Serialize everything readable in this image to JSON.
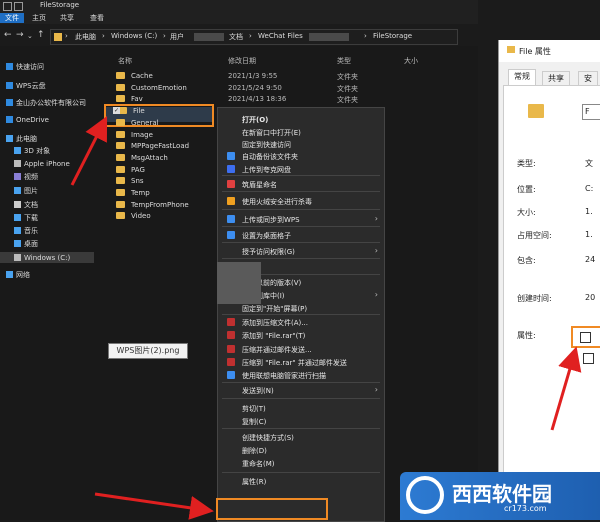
{
  "window": {
    "title": "FileStorage"
  },
  "ribbon": {
    "tabs": [
      "文件",
      "主页",
      "共享",
      "查看"
    ]
  },
  "address": {
    "crumbs": [
      "此电脑",
      "Windows (C:)",
      "用户",
      "文档",
      "WeChat Files",
      "FileStorage"
    ]
  },
  "sidebar": {
    "items": [
      {
        "label": "快速访问",
        "icon": "star-icon",
        "color": "#2f8ae0"
      },
      {
        "label": "WPS云盘",
        "icon": "cloud-icon",
        "color": "#2f8ae0"
      },
      {
        "label": "金山办公软件有限公司",
        "icon": "cloud-icon",
        "color": "#2f8ae0"
      },
      {
        "label": "OneDrive",
        "icon": "onedrive-icon",
        "color": "#2f8ae0"
      },
      {
        "label": "此电脑",
        "icon": "computer-icon",
        "color": "#4aa3f0"
      },
      {
        "label": "3D 对象",
        "icon": "cube-icon",
        "color": "#4aa3f0"
      },
      {
        "label": "Apple iPhone",
        "icon": "phone-icon",
        "color": "#bbbbbb"
      },
      {
        "label": "视频",
        "icon": "video-icon",
        "color": "#8a7fd6"
      },
      {
        "label": "图片",
        "icon": "picture-icon",
        "color": "#4aa3f0"
      },
      {
        "label": "文档",
        "icon": "document-icon",
        "color": "#cccccc"
      },
      {
        "label": "下载",
        "icon": "download-icon",
        "color": "#4aa3f0"
      },
      {
        "label": "音乐",
        "icon": "music-icon",
        "color": "#4aa3f0"
      },
      {
        "label": "桌面",
        "icon": "desktop-icon",
        "color": "#4aa3f0"
      },
      {
        "label": "Windows (C:)",
        "icon": "drive-icon",
        "color": "#bbbbbb"
      },
      {
        "label": "网络",
        "icon": "network-icon",
        "color": "#4aa3f0"
      }
    ]
  },
  "columns": {
    "name": "名称",
    "date": "修改日期",
    "type": "类型",
    "size": "大小"
  },
  "files": [
    {
      "name": "Cache",
      "date": "2021/1/3 9:55",
      "type": "文件夹"
    },
    {
      "name": "CustomEmotion",
      "date": "2021/5/24 9:50",
      "type": "文件夹"
    },
    {
      "name": "Fav",
      "date": "2021/4/13 18:36",
      "type": "文件夹"
    },
    {
      "name": "File",
      "date": "",
      "type": ""
    },
    {
      "name": "General",
      "date": "",
      "type": ""
    },
    {
      "name": "Image",
      "date": "",
      "type": ""
    },
    {
      "name": "MPPageFastLoad",
      "date": "",
      "type": ""
    },
    {
      "name": "MsgAttach",
      "date": "",
      "type": ""
    },
    {
      "name": "PAG",
      "date": "",
      "type": ""
    },
    {
      "name": "Sns",
      "date": "",
      "type": ""
    },
    {
      "name": "Temp",
      "date": "",
      "type": ""
    },
    {
      "name": "TempFromPhone",
      "date": "",
      "type": ""
    },
    {
      "name": "Video",
      "date": "",
      "type": ""
    }
  ],
  "context_menu": {
    "items": [
      {
        "label": "打开(O)",
        "bold": true
      },
      {
        "label": "在新窗口中打开(E)"
      },
      {
        "label": "固定到快速访问"
      },
      {
        "label": "自动备份该文件夹",
        "icon_color": "#3d8ef0"
      },
      {
        "label": "上传到夸克网盘",
        "icon_color": "#3d6ef0"
      },
      {
        "label": "筑盾星命名",
        "icon_color": "#e04040"
      },
      {
        "label": "使用火绒安全进行杀毒",
        "icon_color": "#f0a020"
      },
      {
        "label": "上传或同步到WPS",
        "icon_color": "#3d8ef0",
        "submenu": true
      },
      {
        "label": "设置为桌面格子",
        "icon_color": "#3d8ef0"
      },
      {
        "label": "授予访问权限(G)",
        "submenu": true
      },
      {
        "label": "还原以前的版本(V)"
      },
      {
        "label": "包含到库中(I)",
        "submenu": true
      },
      {
        "label": "固定到\"开始\"屏幕(P)"
      },
      {
        "label": "添加到压缩文件(A)...",
        "icon_color": "#c03030"
      },
      {
        "label": "添加到 \"File.rar\"(T)",
        "icon_color": "#c03030"
      },
      {
        "label": "压缩并通过邮件发送...",
        "icon_color": "#c03030"
      },
      {
        "label": "压缩到 \"File.rar\" 并通过邮件发送",
        "icon_color": "#c03030"
      },
      {
        "label": "使用联想电脑管家进行扫描",
        "icon_color": "#3d8ef0"
      },
      {
        "label": "发送到(N)",
        "submenu": true
      },
      {
        "label": "剪切(T)"
      },
      {
        "label": "复制(C)"
      },
      {
        "label": "创建快捷方式(S)"
      },
      {
        "label": "删除(D)"
      },
      {
        "label": "重命名(M)"
      },
      {
        "label": "属性(R)"
      }
    ]
  },
  "tooltip": {
    "text": "WPS图片(2).png"
  },
  "properties": {
    "title": "File 属性",
    "tabs": [
      "常规",
      "共享",
      "安"
    ],
    "rows": [
      {
        "label": "类型:",
        "value": "文"
      },
      {
        "label": "位置:",
        "value": "C:"
      },
      {
        "label": "大小:",
        "value": "1."
      },
      {
        "label": "占用空间:",
        "value": "1."
      },
      {
        "label": "包含:",
        "value": "24"
      },
      {
        "label": "创建时间:",
        "value": "20"
      },
      {
        "label": "属性:",
        "value": ""
      }
    ],
    "name_value": "F"
  },
  "watermark": {
    "brand": "西西软件园",
    "url": "cr173.com",
    "logo_letter": "Cr"
  },
  "colors": {
    "accent_orange": "#f08a24",
    "arrow_red": "#e02020",
    "folder": "#e9b84a"
  }
}
